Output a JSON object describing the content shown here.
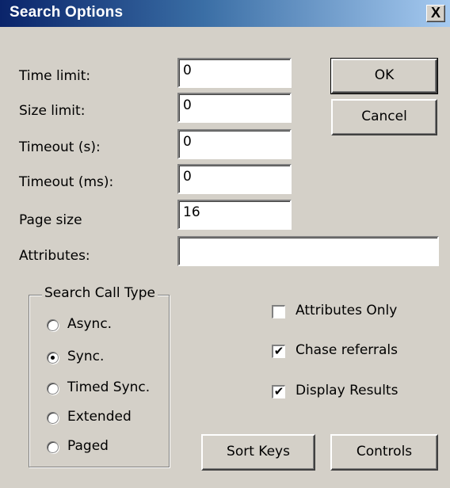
{
  "window": {
    "title": "Search Options",
    "close_glyph": "X"
  },
  "fields": [
    {
      "label": "Time limit:",
      "value": "0"
    },
    {
      "label": "Size limit:",
      "value": "0"
    },
    {
      "label": "Timeout (s):",
      "value": "0"
    },
    {
      "label": "Timeout (ms):",
      "value": "0"
    },
    {
      "label": "Page size",
      "value": "16"
    },
    {
      "label": "Attributes:",
      "value": ""
    }
  ],
  "buttons": {
    "ok": "OK",
    "cancel": "Cancel",
    "sort_keys": "Sort Keys",
    "controls": "Controls"
  },
  "search_call_type": {
    "title": "Search Call Type",
    "options": [
      {
        "label": "Async.",
        "selected": false
      },
      {
        "label": "Sync.",
        "selected": true
      },
      {
        "label": "Timed Sync.",
        "selected": false
      },
      {
        "label": "Extended",
        "selected": false
      },
      {
        "label": "Paged",
        "selected": false
      }
    ]
  },
  "checkboxes": [
    {
      "label": "Attributes Only",
      "checked": false
    },
    {
      "label": "Chase referrals",
      "checked": true
    },
    {
      "label": "Display Results",
      "checked": true
    }
  ],
  "check_glyph": "✔"
}
